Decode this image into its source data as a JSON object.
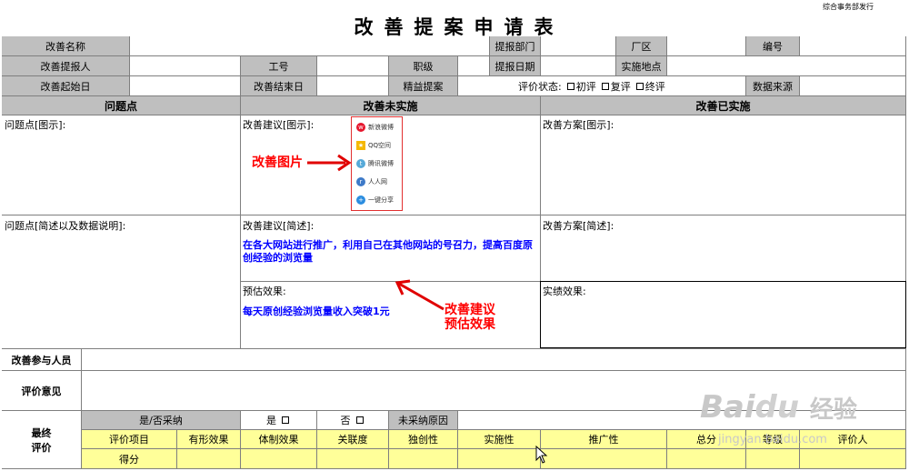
{
  "top_note": "综合事务部发行",
  "title": "改善提案申请表",
  "row1": {
    "name": "改善名称",
    "dept": "提报部门",
    "factory": "厂区",
    "number": "编号"
  },
  "row2": {
    "proposer": "改善提报人",
    "job_no": "工号",
    "position": "职级",
    "date": "提报日期",
    "location": "实施地点"
  },
  "row3": {
    "start": "改善起始日",
    "end": "改善结束日",
    "lean": "精益提案",
    "eval_state": "评价状态:",
    "first": "初评",
    "second": "复评",
    "final": "终评",
    "source": "数据来源"
  },
  "sections": {
    "problem": "问题点",
    "not_done": "改善未实施",
    "done": "改善已实施"
  },
  "cells": {
    "problem_pic": "问题点[图示]:",
    "suggest_pic": "改善建议[图示]:",
    "plan_pic": "改善方案[图示]:",
    "problem_desc": "问题点[简述以及数据说明]:",
    "suggest_desc": "改善建议[简述]:",
    "plan_desc": "改善方案[简述]:",
    "expected": "预估效果:",
    "actual": "实绩效果:"
  },
  "blue_text": {
    "suggestion": "在各大网站进行推广，利用自己在其他网站的号召力，提高百度原创经验的浏览量",
    "expected": "每天原创经验浏览量收入突破1元"
  },
  "annotations": {
    "image": "改善图片",
    "expected_line1": "改善建议",
    "expected_line2": "预估效果"
  },
  "share_items": [
    "新浪微博",
    "QQ空间",
    "腾讯微博",
    "人人网",
    "一键分享"
  ],
  "participants": "改善参与人员",
  "opinion": "评价意见",
  "final": {
    "line1": "最终",
    "line2": "评价"
  },
  "adopt": {
    "label": "是/否采纳",
    "yes": "是",
    "no": "否",
    "reason": "未采纳原因"
  },
  "eval_headers": [
    "评价项目",
    "有形效果",
    "体制效果",
    "关联度",
    "独创性",
    "实施性",
    "推广性",
    "总分",
    "等级",
    "评价人"
  ],
  "score": "得分",
  "watermark": {
    "brand": "Bai",
    "paw": "du",
    "cn": "经验",
    "url": "jingyan.baidu.com"
  }
}
